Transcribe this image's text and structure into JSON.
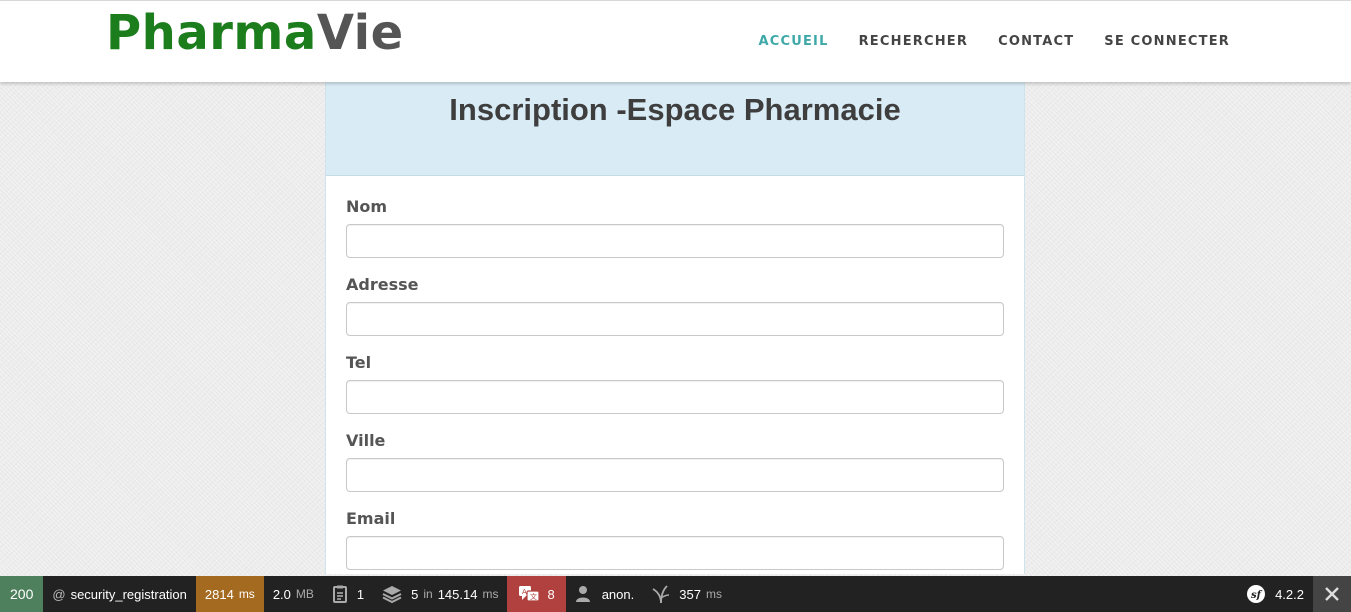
{
  "header": {
    "logo_part1": "Pharma",
    "logo_part2": "Vie",
    "nav": [
      {
        "label": "ACCUEIL",
        "active": true
      },
      {
        "label": "RECHERCHER"
      },
      {
        "label": "CONTACT"
      },
      {
        "label": "SE CONNECTER"
      }
    ]
  },
  "card": {
    "title": "Inscription -Espace Pharmacie",
    "fields": [
      {
        "label": "Nom",
        "value": ""
      },
      {
        "label": "Adresse",
        "value": ""
      },
      {
        "label": "Tel",
        "value": ""
      },
      {
        "label": "Ville",
        "value": ""
      },
      {
        "label": "Email",
        "value": ""
      }
    ]
  },
  "toolbar": {
    "status_code": "200",
    "route_prefix": "@",
    "route": "security_registration",
    "time_value": "2814",
    "time_unit": "ms",
    "memory_value": "2.0",
    "memory_unit": "MB",
    "forms_count": "1",
    "doctrine_queries": "5",
    "doctrine_in": "in",
    "doctrine_time": "145.14",
    "doctrine_unit": "ms",
    "translations_count": "8",
    "user": "anon.",
    "events_time": "357",
    "events_unit": "ms",
    "version": "4.2.2",
    "colors": {
      "status": "#4f805d",
      "time": "#a46a1f",
      "translations": "#b0413e"
    }
  },
  "icons": [
    "form-icon",
    "database-icon",
    "translation-icon",
    "user-icon",
    "events-icon",
    "symfony-icon",
    "close-icon"
  ]
}
